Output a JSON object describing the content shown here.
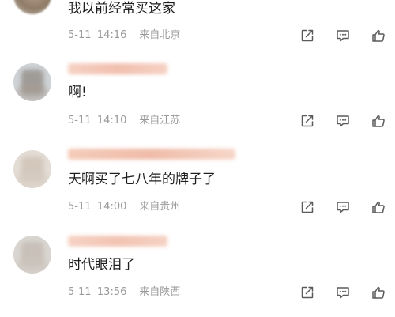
{
  "comments": [
    {
      "text": "我以前经常买这家",
      "date": "5-11",
      "time": "14:16",
      "location": "来自北京"
    },
    {
      "text": "啊!",
      "date": "5-11",
      "time": "14:10",
      "location": "来自江苏"
    },
    {
      "text": "天啊买了七八年的牌子了",
      "date": "5-11",
      "time": "14:00",
      "location": "来自贵州"
    },
    {
      "text": "时代眼泪了",
      "date": "5-11",
      "time": "13:56",
      "location": "来自陕西"
    }
  ],
  "icons": {
    "share": "share-icon",
    "comment": "comment-icon",
    "like": "thumbs-up-icon"
  },
  "colors": {
    "text": "#1e1e1e",
    "meta": "#9a9a9a",
    "icon": "#5a5a5a",
    "username_blur": "#f4c9b6"
  }
}
